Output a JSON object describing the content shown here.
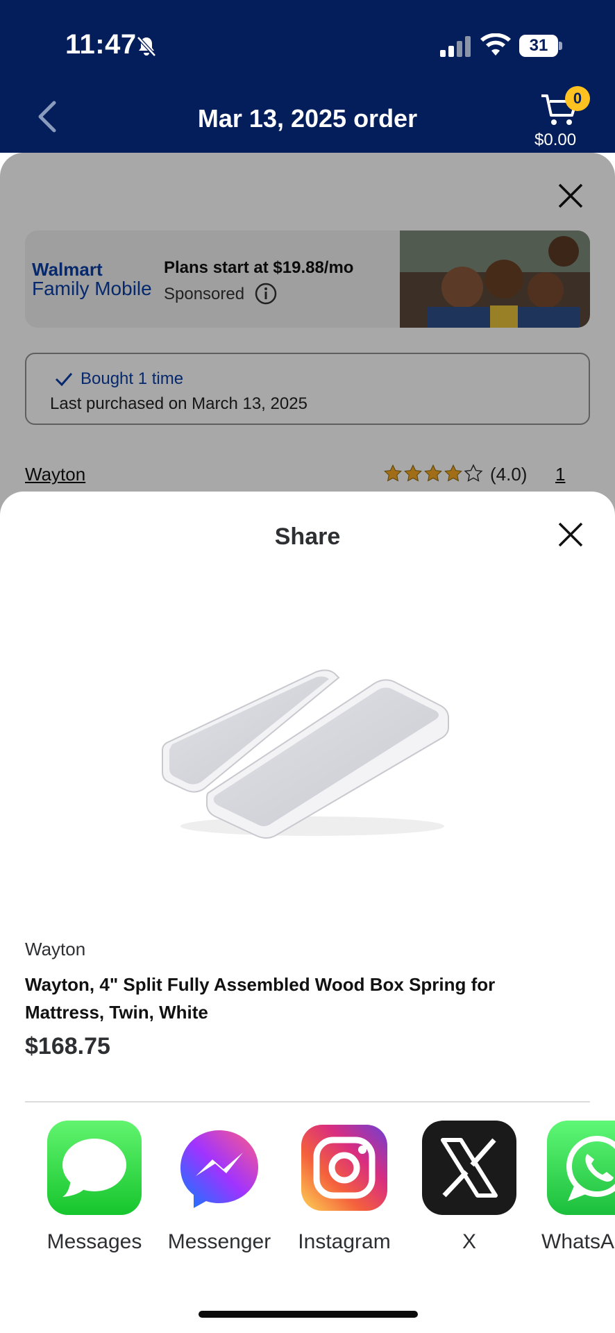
{
  "status_bar": {
    "time": "11:47",
    "battery": "31"
  },
  "header": {
    "title": "Mar 13, 2025 order",
    "cart_count": "0",
    "cart_total": "$0.00"
  },
  "order_sheet": {
    "ad": {
      "brand_line1": "Walmart",
      "brand_line2": "Family Mobile",
      "headline": "Plans start at $19.88/mo",
      "sponsored": "Sponsored"
    },
    "purchase_history": {
      "line1": "Bought 1 time",
      "line2": "Last purchased on March 13, 2025"
    },
    "brand_link": "Wayton",
    "rating": "(4.0)",
    "stars": 4,
    "review_count": "1"
  },
  "share_sheet": {
    "title": "Share",
    "product": {
      "brand": "Wayton",
      "title": "Wayton, 4\" Split Fully Assembled Wood Box Spring for Mattress, Twin, White",
      "price": "$168.75"
    },
    "apps": [
      {
        "label": "Messages",
        "icon": "messages-icon"
      },
      {
        "label": "Messenger",
        "icon": "messenger-icon"
      },
      {
        "label": "Instagram",
        "icon": "instagram-icon"
      },
      {
        "label": "X",
        "icon": "x-icon"
      },
      {
        "label": "WhatsA",
        "icon": "whatsapp-icon"
      }
    ]
  },
  "colors": {
    "header_bg": "#041e5b",
    "walmart_blue": "#0a3ea6",
    "cart_badge": "#ffc220",
    "star": "#f5a623"
  }
}
